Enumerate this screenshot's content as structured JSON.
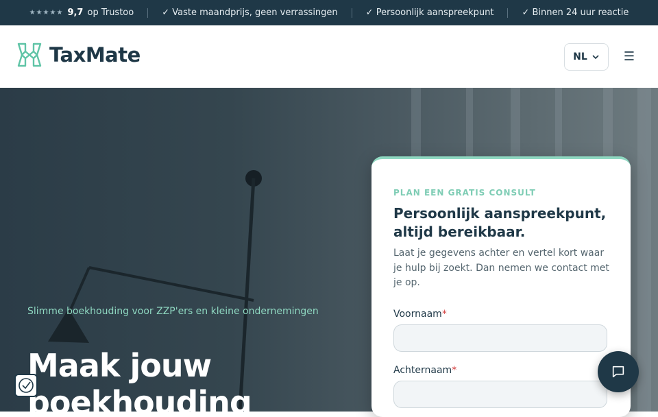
{
  "topbar": {
    "rating_stars": "★★★★★",
    "rating_score": "9,7",
    "rating_text": "op Trustoo",
    "usp1": "✓ Vaste maandprijs, geen verrassingen",
    "usp2": "✓ Persoonlijk aanspreekpunt",
    "usp3": "✓ Binnen 24 uur reactie"
  },
  "header": {
    "brand": "TaxMate",
    "language": "NL",
    "menu_icon": "☰"
  },
  "hero": {
    "subtitle": "Slimme boekhouding voor ZZP'ers en kleine ondernemingen",
    "title_line1": "Maak jouw",
    "title_line2": "boekhouding"
  },
  "form": {
    "eyebrow": "PLAN EEN GRATIS CONSULT",
    "heading": "Persoonlijk aanspreekpunt, altijd bereikbaar.",
    "description": "Laat je gegevens achter en vertel kort waar je hulp bij zoekt. Dan nemen we contact met je op.",
    "first_name_label": "Voornaam",
    "last_name_label": "Achternaam",
    "required_mark": "*",
    "first_name_value": "",
    "last_name_value": ""
  },
  "colors": {
    "brand_dark": "#1f3847",
    "accent_mint": "#8fd8c1"
  },
  "icons": {
    "logo": "taxmate-logo-icon",
    "chevron": "chevron-down-icon",
    "chat": "chat-bubble-icon",
    "cookie": "cookie-consent-icon"
  }
}
